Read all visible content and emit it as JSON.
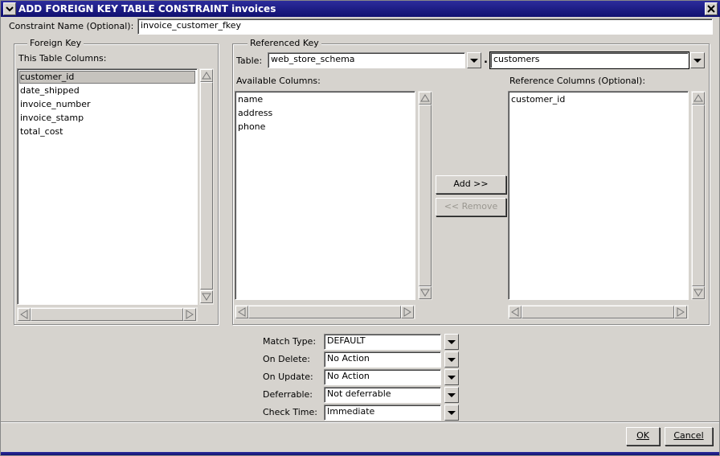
{
  "window": {
    "title": "ADD FOREIGN KEY TABLE CONSTRAINT invoices"
  },
  "constraint": {
    "label": "Constraint Name (Optional):",
    "value": "invoice_customer_fkey"
  },
  "foreign_key": {
    "group_title": "Foreign Key",
    "columns_label": "This Table Columns:",
    "columns": [
      "customer_id",
      "date_shipped",
      "invoice_number",
      "invoice_stamp",
      "total_cost"
    ],
    "selected": "customer_id"
  },
  "referenced_key": {
    "group_title": "Referenced Key",
    "table_label": "Table:",
    "schema": "web_store_schema",
    "dot": ".",
    "table": "customers",
    "available_label": "Available Columns:",
    "available": [
      "name",
      "address",
      "phone"
    ],
    "reference_label": "Reference Columns (Optional):",
    "reference": [
      "customer_id"
    ]
  },
  "buttons": {
    "add": "Add >>",
    "remove": "<< Remove",
    "ok": "OK",
    "cancel": "Cancel"
  },
  "options": {
    "match_type_label": "Match Type:",
    "match_type": "DEFAULT",
    "on_delete_label": "On Delete:",
    "on_delete": "No Action",
    "on_update_label": "On Update:",
    "on_update": "No Action",
    "deferrable_label": "Deferrable:",
    "deferrable": "Not deferrable",
    "check_time_label": "Check Time:",
    "check_time": "Immediate"
  },
  "colors": {
    "title_bar": "#1c1c84",
    "window_bg": "#d6d3ce"
  }
}
